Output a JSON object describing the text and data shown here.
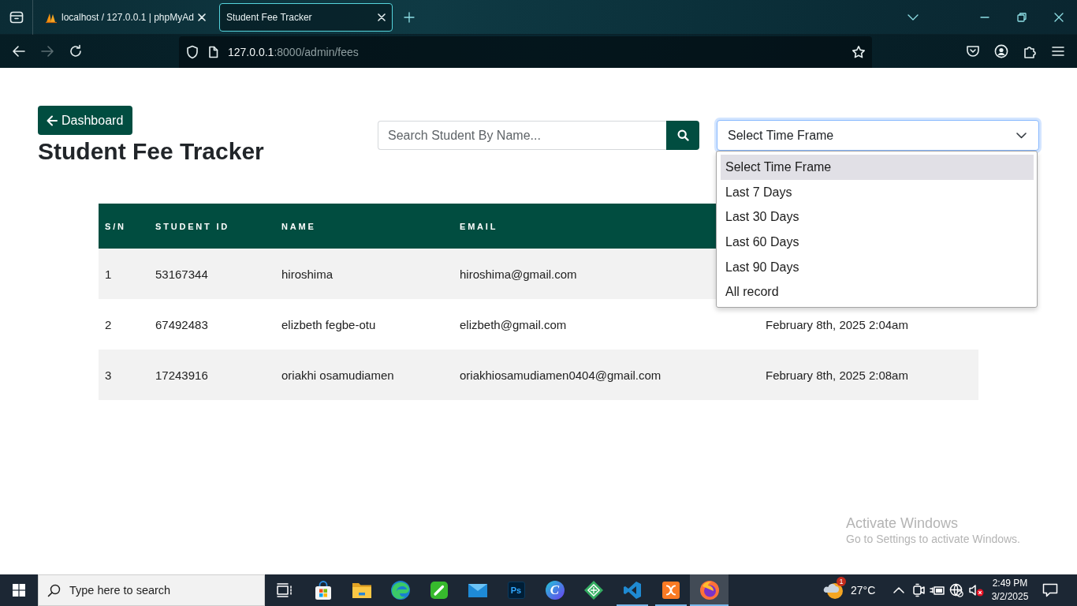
{
  "browser": {
    "tabs": [
      {
        "title": "localhost / 127.0.0.1 | phpMyAd",
        "favicon": true,
        "selected": false
      },
      {
        "title": "Student Fee Tracker",
        "favicon": false,
        "selected": true
      }
    ],
    "navigation": [
      {
        "kind": "back",
        "disabled": false
      },
      {
        "kind": "forward",
        "disabled": true
      },
      {
        "kind": "reload",
        "disabled": false
      }
    ],
    "address": {
      "host": "127.0.0.1",
      "path": ":8000/admin/fees"
    }
  },
  "page": {
    "back_button": "Dashboard",
    "title": "Student Fee Tracker",
    "search": {
      "placeholder": "Search Student By Name..."
    },
    "time_frame": {
      "value": "Select Time Frame",
      "expanded": true,
      "options": [
        {
          "label": "Select Time Frame",
          "selected": true
        },
        {
          "label": "Last 7 Days",
          "selected": false
        },
        {
          "label": "Last 30 Days",
          "selected": false
        },
        {
          "label": "Last 60 Days",
          "selected": false
        },
        {
          "label": "Last 90 Days",
          "selected": false
        },
        {
          "label": "All record",
          "selected": false
        }
      ]
    },
    "table": {
      "columns": [
        "S/N",
        "STUDENT ID",
        "NAME",
        "EMAIL"
      ],
      "rows": [
        {
          "cells": [
            "1",
            "53167344",
            "hiroshima",
            "hiroshima@gmail.com"
          ]
        },
        {
          "cells": [
            "2",
            "67492483",
            "elizbeth fegbe-otu",
            "elizbeth@gmail.com",
            "February 8th, 2025 2:04am"
          ]
        },
        {
          "cells": [
            "3",
            "17243916",
            "oriakhi osamudiamen",
            "oriakhiosamudiamen0404@gmail.com",
            "February 8th, 2025 2:08am"
          ]
        }
      ]
    }
  },
  "activation_notice": {
    "title": "Activate Windows",
    "subtitle": "Go to Settings to activate Windows."
  },
  "taskbar": {
    "search": {
      "placeholder": "Type here to search"
    },
    "apps": [
      {
        "kind": "task-view",
        "running": false,
        "selected": false
      },
      {
        "kind": "store",
        "running": false,
        "selected": false
      },
      {
        "kind": "explorer",
        "running": false,
        "selected": false
      },
      {
        "kind": "edge",
        "running": false,
        "selected": false
      },
      {
        "kind": "notes",
        "running": false,
        "selected": false
      },
      {
        "kind": "mail",
        "running": false,
        "selected": false
      },
      {
        "kind": "photoshop",
        "label": "Ps",
        "running": false,
        "selected": false
      },
      {
        "kind": "canva",
        "label": "C",
        "running": false,
        "selected": false
      },
      {
        "kind": "diamond",
        "running": false,
        "selected": false
      },
      {
        "kind": "vscode",
        "running": true,
        "selected": false
      },
      {
        "kind": "xampp",
        "running": true,
        "selected": false
      },
      {
        "kind": "firefox",
        "running": true,
        "selected": true
      }
    ],
    "weather": {
      "badge": "1",
      "temperature": "27°C"
    },
    "clock": {
      "time": "2:49 PM",
      "date": "3/2/2025"
    }
  }
}
